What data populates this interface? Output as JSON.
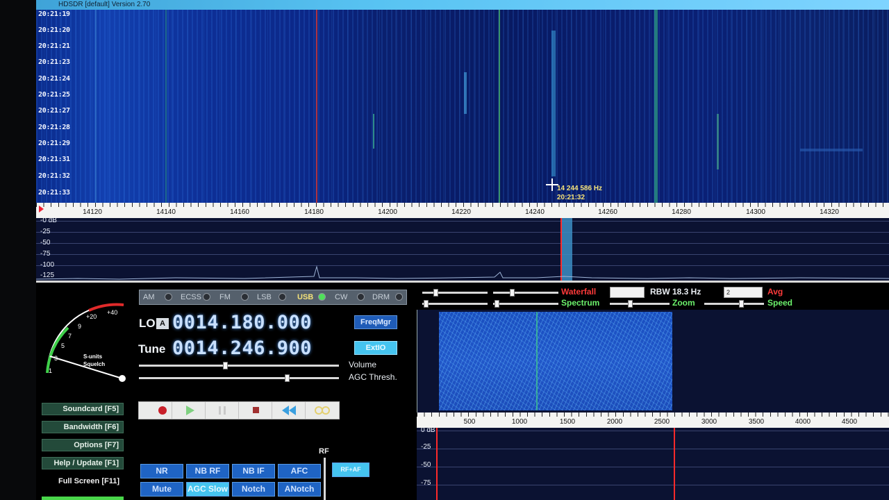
{
  "window": {
    "title": "HDSDR [default] Version 2.70"
  },
  "waterfall": {
    "timestamps": [
      "20:21:19",
      "20:21:20",
      "20:21:21",
      "20:21:23",
      "20:21:24",
      "20:21:25",
      "20:21:27",
      "20:21:28",
      "20:21:29",
      "20:21:31",
      "20:21:32",
      "20:21:33"
    ],
    "cursor_freq": "14 244 586 Hz",
    "cursor_time": "20:21:32"
  },
  "freq_scale": {
    "labels": [
      "14120",
      "14140",
      "14160",
      "14180",
      "14200",
      "14220",
      "14240",
      "14260",
      "14280",
      "14300",
      "14320"
    ]
  },
  "spectrum": {
    "db_labels": [
      "-0 dB",
      "-25",
      "-50",
      "-75",
      "-100",
      "-125"
    ]
  },
  "smeter": {
    "labels": [
      "+20",
      "+40",
      "9",
      "7",
      "5",
      "3",
      "1"
    ],
    "caption1": "S-units",
    "caption2": "Squelch"
  },
  "menu": {
    "soundcard": "Soundcard  [F5]",
    "bandwidth": "Bandwidth  [F6]",
    "options": "Options     [F7]",
    "help": "Help / Update  [F1]",
    "fullscreen": "Full Screen  [F11]"
  },
  "modes": {
    "am": "AM",
    "ecss": "ECSS",
    "fm": "FM",
    "lsb": "LSB",
    "usb": "USB",
    "cw": "CW",
    "drm": "DRM",
    "active": "USB"
  },
  "lo": {
    "label": "LO",
    "badge": "A",
    "value": "0014.180.000"
  },
  "tune": {
    "label": "Tune",
    "value": "0014.246.900"
  },
  "buttons": {
    "freqmgr": "FreqMgr",
    "extio": "ExtIO"
  },
  "sliders": {
    "volume_label": "Volume",
    "agc_label": "AGC Thresh.",
    "volume_level": 0.43,
    "agc_level": 0.74
  },
  "dsp": {
    "nr": "NR",
    "nbrf": "NB RF",
    "nbif": "NB IF",
    "afc": "AFC",
    "mute": "Mute",
    "agc_slow": "AGC Slow",
    "notch": "Notch",
    "anotch": "ANotch",
    "rf_label": "RF",
    "rf_af": "RF+AF"
  },
  "right": {
    "waterfall": "Waterfall",
    "spectrum": "Spectrum",
    "rbw": "RBW 18.3 Hz",
    "zoom": "Zoom",
    "avg": "Avg",
    "speed": "Speed",
    "avg_value": "2"
  },
  "audio_scale": {
    "labels": [
      "500",
      "1000",
      "1500",
      "2000",
      "2500",
      "3000",
      "3500",
      "4000",
      "4500"
    ]
  },
  "audio_spectrum": {
    "db_labels": [
      "0 dB",
      "-25",
      "-50",
      "-75"
    ]
  },
  "colors": {
    "accent": "#1f64c4",
    "active": "#45c4f0",
    "red": "#ff2a2a",
    "warn": "#ff3a3a",
    "green": "#6cf26c"
  }
}
